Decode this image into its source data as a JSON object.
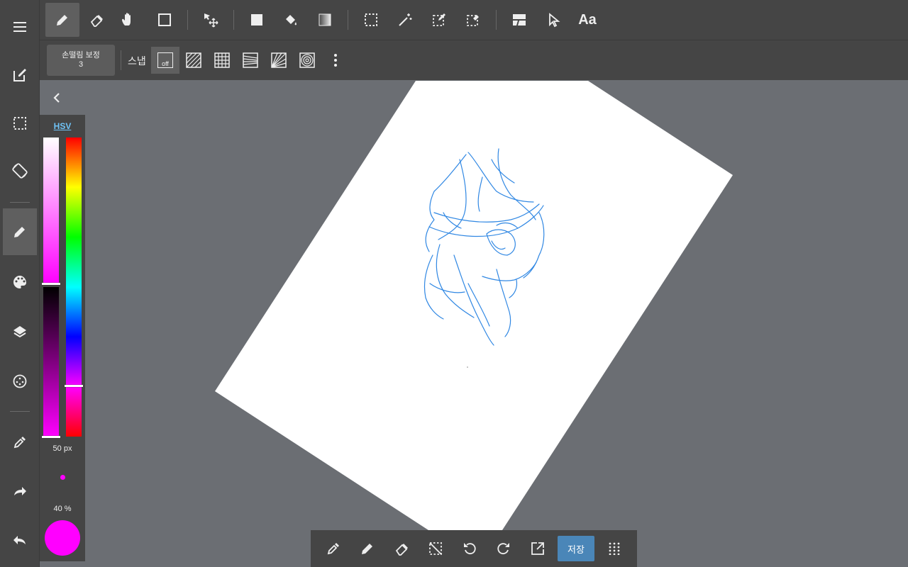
{
  "top_toolbar": {
    "tools": [
      "pen-tool",
      "eraser-tool",
      "hand-tool",
      "shape-tool",
      "move-tool",
      "fill-rect-tool",
      "bucket-tool",
      "gradient-tool",
      "select-rect-tool",
      "magic-wand-tool",
      "select-pen-tool",
      "select-eraser-tool",
      "frame-divider-tool",
      "operation-tool",
      "text-tool"
    ],
    "text_tool_label": "Aa"
  },
  "sub_toolbar": {
    "stabilizer_label": "손떨림 보정",
    "stabilizer_value": "3",
    "snap_label": "스냅",
    "snap_off_label": "off"
  },
  "color_panel": {
    "mode_tab": "HSV",
    "brush_size": "50 px",
    "opacity": "40 %",
    "current_color": "#ff00ff",
    "saturation_level": 1.0,
    "value_level": 1.0,
    "hue_level": 0.83
  },
  "bottom_bar": {
    "save_label": "저장"
  },
  "colors": {
    "toolbar_bg": "#454545",
    "workspace_bg": "#6b6e73",
    "sketch_stroke": "#1a7be0",
    "accent": "#4a86b8"
  }
}
